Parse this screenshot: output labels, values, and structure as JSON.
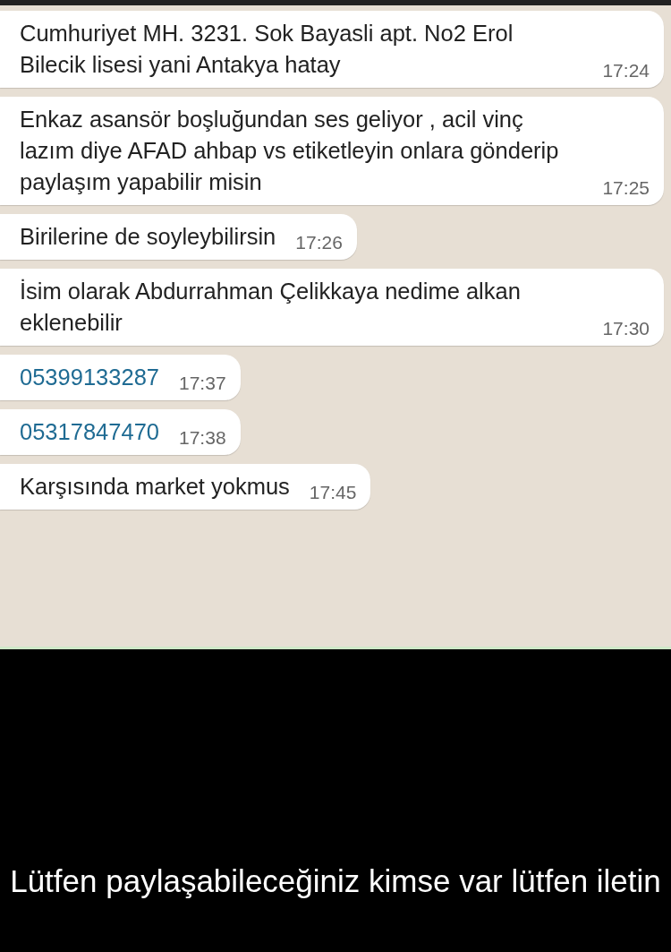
{
  "messages": [
    {
      "kind": "text",
      "text": "Cumhuriyet MH. 3231. Sok Bayasli apt. No2 Erol Bilecik lisesi yani Antakya hatay",
      "time": "17:24"
    },
    {
      "kind": "text",
      "text": "Enkaz asansör boşluğundan ses geliyor , acil vinç lazım diye AFAD ahbap vs etiketleyin onlara gönderip paylaşım yapabilir misin",
      "time": "17:25"
    },
    {
      "kind": "text",
      "text": "Birilerine de soyleybilirsin",
      "time": "17:26"
    },
    {
      "kind": "text",
      "text": "İsim olarak Abdurrahman Çelikkaya nedime alkan eklenebilir",
      "time": "17:30"
    },
    {
      "kind": "phone",
      "text": "05399133287",
      "time": "17:37"
    },
    {
      "kind": "phone",
      "text": "05317847470",
      "time": "17:38"
    },
    {
      "kind": "text",
      "text": "Karşısında market yokmus",
      "time": "17:45"
    }
  ],
  "caption": "Lütfen paylaşabileceğiniz kimse var lütfen iletin"
}
